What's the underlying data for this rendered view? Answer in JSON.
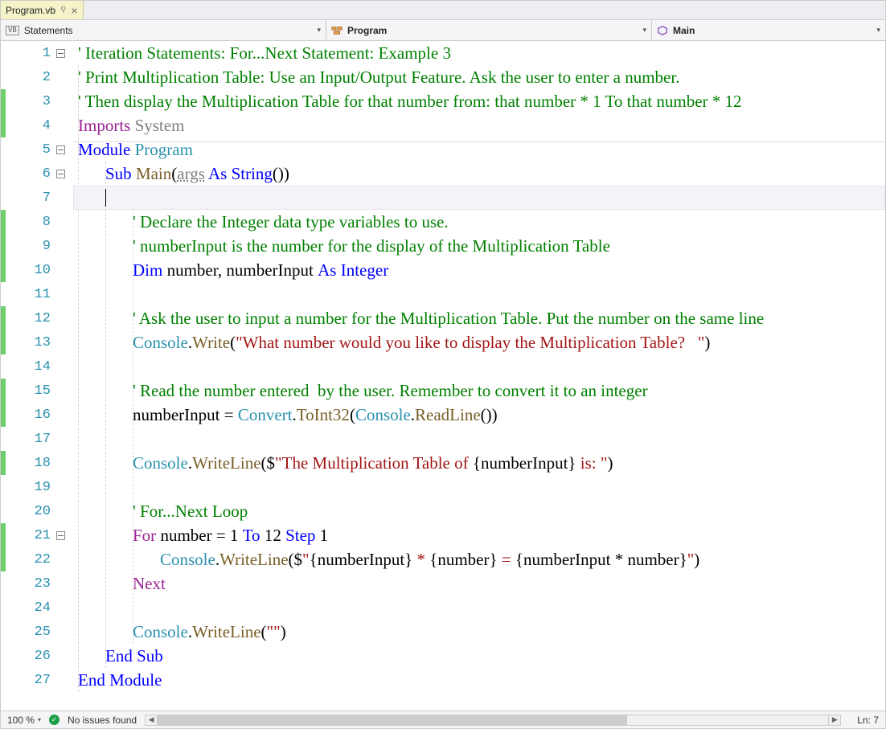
{
  "tab": {
    "filename": "Program.vb",
    "pin_glyph": "⚲",
    "close_glyph": "×"
  },
  "nav": {
    "scope": "Statements",
    "type": "Program",
    "member": "Main",
    "vb_badge": "VB",
    "dd_glyph": "▾"
  },
  "status": {
    "zoom": "100 %",
    "issues": "No issues found",
    "check_glyph": "✓",
    "line_info": "Ln: 7",
    "zoom_dd": "▾",
    "scroll_left": "◀",
    "scroll_right": "▶"
  },
  "fold": {
    "minus": "−"
  },
  "code": {
    "l1": {
      "c": "' Iteration Statements: For...Next Statement: Example 3"
    },
    "l2": {
      "c": "' Print Multiplication Table: Use an Input/Output Feature. Ask the user to enter a number."
    },
    "l3": {
      "c": "' Then display the Multiplication Table for that number from: that number * 1 To that number * 12"
    },
    "l4": {
      "imports": "Imports",
      "sys": " System"
    },
    "l5": {
      "module": "Module",
      "name": " Program"
    },
    "l6": {
      "sub": "Sub",
      "main": " Main",
      "lp": "(",
      "args": "args",
      "as": " As ",
      "str": "String",
      "rp": "())"
    },
    "l8": {
      "c": "' Declare the Integer data type variables to use."
    },
    "l9": {
      "c": "' numberInput is the number for the display of the Multiplication Table"
    },
    "l10": {
      "dim": "Dim",
      "vars": " number, numberInput ",
      "as": "As ",
      "int": "Integer"
    },
    "l12": {
      "c": "' Ask the user to input a number for the Multiplication Table. Put the number on the same line"
    },
    "l13": {
      "con": "Console",
      "dot": ".",
      "wr": "Write",
      "lp": "(",
      "s": "\"What number would you like to display the Multiplication Table?   \"",
      "rp": ")"
    },
    "l15": {
      "c": "' Read the number entered  by the user. Remember to convert it to an integer"
    },
    "l16": {
      "a": "numberInput = ",
      "conv": "Convert",
      "d1": ".",
      "toi": "ToInt32",
      "lp": "(",
      "con": "Console",
      "d2": ".",
      "rl": "ReadLine",
      "rp": "())"
    },
    "l18": {
      "con": "Console",
      "d": ".",
      "wl": "WriteLine",
      "lp": "($",
      "s1": "\"The Multiplication Table of ",
      "ob": "{numberInput}",
      "s2": " is: \"",
      "rp": ")"
    },
    "l20": {
      "c": "' For...Next Loop"
    },
    "l21": {
      "for": "For",
      "a": " number = 1 ",
      "to": "To",
      "b": " 12 ",
      "step": "Step",
      "cnum": " 1"
    },
    "l22": {
      "con": "Console",
      "d": ".",
      "wl": "WriteLine",
      "lp": "($",
      "s1": "\"",
      "e1": "{numberInput}",
      "s2": " * ",
      "e2": "{number}",
      "s3": " = ",
      "e3": "{numberInput * number}",
      "s4": "\"",
      "rp": ")"
    },
    "l23": {
      "next": "Next"
    },
    "l25": {
      "con": "Console",
      "d": ".",
      "wl": "WriteLine",
      "lp": "(",
      "s": "\"\"",
      "rp": ")"
    },
    "l26": {
      "es": "End Sub"
    },
    "l27": {
      "em": "End Module"
    }
  },
  "lines": [
    "1",
    "2",
    "3",
    "4",
    "5",
    "6",
    "7",
    "8",
    "9",
    "10",
    "11",
    "12",
    "13",
    "14",
    "15",
    "16",
    "17",
    "18",
    "19",
    "20",
    "21",
    "22",
    "23",
    "24",
    "25",
    "26",
    "27"
  ]
}
